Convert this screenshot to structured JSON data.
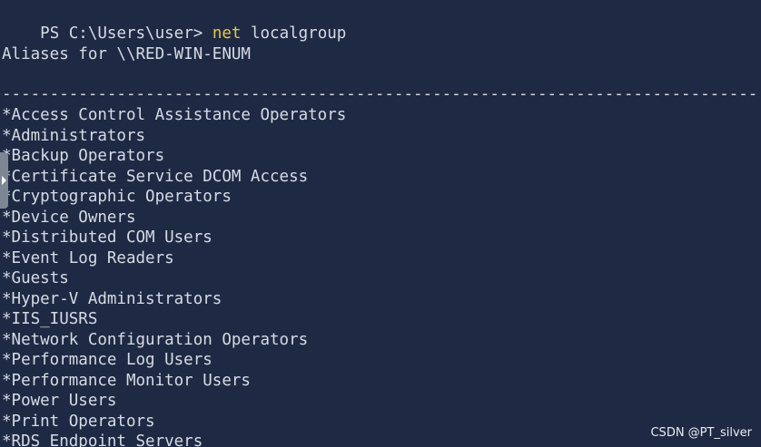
{
  "prompt": "PS C:\\Users\\user> ",
  "command": "net",
  "command_args": " localgroup",
  "header": "Aliases for \\\\RED-WIN-ENUM",
  "divider": "-------------------------------------------------------------------------------",
  "groups": [
    "*Access Control Assistance Operators",
    "*Administrators",
    "*Backup Operators",
    "*Certificate Service DCOM Access",
    "*Cryptographic Operators",
    "*Device Owners",
    "*Distributed COM Users",
    "*Event Log Readers",
    "*Guests",
    "*Hyper-V Administrators",
    "*IIS_IUSRS",
    "*Network Configuration Operators",
    "*Performance Log Users",
    "*Performance Monitor Users",
    "*Power Users",
    "*Print Operators",
    "*RDS Endpoint Servers"
  ],
  "watermark": "CSDN @PT_silver",
  "colors": {
    "background": "#1e2a44",
    "text": "#d6dbe4",
    "command": "#e6c84a"
  }
}
